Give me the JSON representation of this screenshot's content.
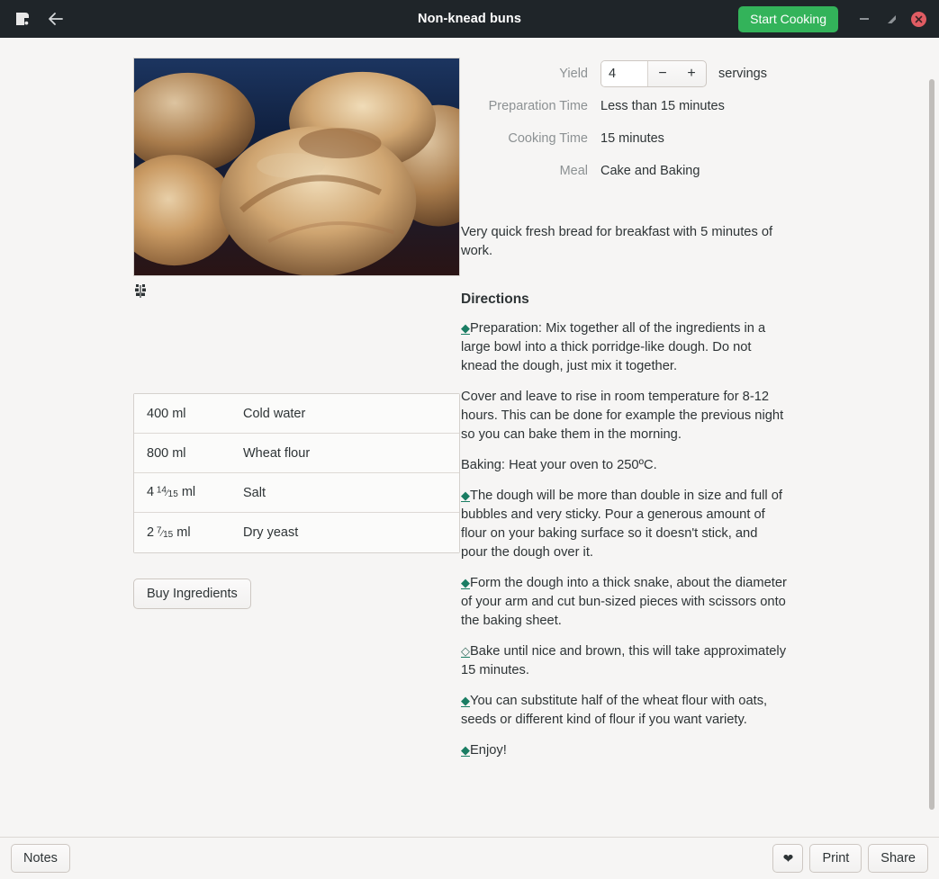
{
  "window": {
    "title": "Non-knead buns",
    "app_icon": "recipe-app-icon",
    "back_icon": "back-arrow-icon",
    "start_cooking_label": "Start Cooking",
    "minimize_icon": "minimize-icon",
    "maximize_icon": "maximize-icon",
    "close_icon": "close-icon",
    "accent_green": "#33b35a",
    "close_red": "#e05c63",
    "headerbar_bg": "#1f2529"
  },
  "photo": {
    "icon": "wheat-grain-icon",
    "alt": "Non-knead buns photo"
  },
  "meta": [
    {
      "label": "Yield",
      "value": "4",
      "unit": "servings",
      "type": "spinner"
    },
    {
      "label": "Preparation Time",
      "value": "Less than 15 minutes",
      "type": "text"
    },
    {
      "label": "Cooking Time",
      "value": "15 minutes",
      "type": "text"
    },
    {
      "label": "Meal",
      "value": "Cake and Baking",
      "type": "text"
    }
  ],
  "yield": {
    "label": "Yield",
    "value": "4",
    "decrement_icon": "minus-icon",
    "increment_icon": "plus-icon",
    "unit": "servings"
  },
  "description": "Very quick fresh bread for breakfast with 5 minutes of work.",
  "directions": {
    "title": "Directions",
    "steps": [
      {
        "bullet": "filled",
        "text": "Preparation: Mix together all of the ingredients in a large bowl into a thick porridge-like dough. Do not knead the dough, just mix it together."
      },
      {
        "bullet": "none",
        "text": "Cover and leave to rise in room temperature for 8-12 hours. This can be done for example the previous night so you can bake them in the morning."
      },
      {
        "bullet": "none",
        "text": "Baking: Heat your oven to 250ºC."
      },
      {
        "bullet": "filled",
        "text": "The dough will be more than double in size and full of bubbles and very sticky. Pour a generous amount of flour on your baking surface so it doesn't stick, and pour the dough over it."
      },
      {
        "bullet": "filled",
        "text": "Form the dough into a thick snake, about the diameter of your arm and cut bun-sized pieces with scissors onto the baking sheet."
      },
      {
        "bullet": "hollow",
        "text": "Bake until nice and brown, this will take approximately 15 minutes."
      },
      {
        "bullet": "filled",
        "text": "You can substitute half of the wheat flour with oats, seeds or different kind of flour if you want variety."
      },
      {
        "bullet": "filled",
        "text": "Enjoy!"
      }
    ]
  },
  "ingredients": [
    {
      "amount": "400 ml",
      "amount_whole": "400",
      "amount_unit": "ml",
      "name": "Cold water"
    },
    {
      "amount": "800 ml",
      "amount_whole": "800",
      "amount_unit": "ml",
      "name": "Wheat flour"
    },
    {
      "amount": "4 14/15 ml",
      "amount_whole": "4",
      "frac_num": "14",
      "frac_den": "15",
      "amount_unit": "ml",
      "name": "Salt"
    },
    {
      "amount": "2 7/15 ml",
      "amount_whole": "2",
      "frac_num": "7",
      "frac_den": "15",
      "amount_unit": "ml",
      "name": "Dry yeast"
    }
  ],
  "buy_ingredients_label": "Buy Ingredients",
  "actionbar": {
    "notes_label": "Notes",
    "favorite_icon": "heart-icon",
    "print_label": "Print",
    "share_label": "Share"
  }
}
